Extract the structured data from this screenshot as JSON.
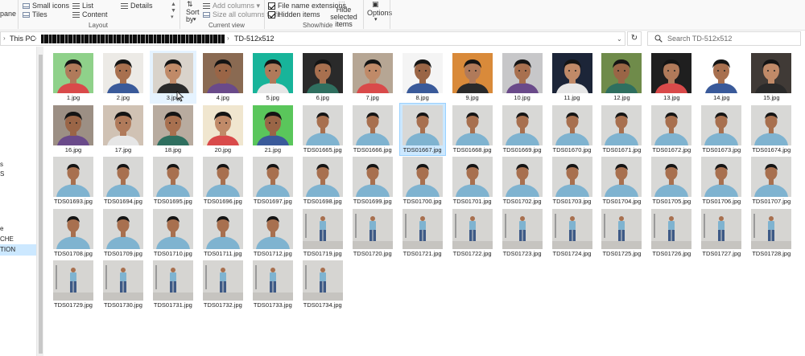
{
  "ribbon": {
    "pane_label": "pane",
    "layout": {
      "items": [
        "Small icons",
        "List",
        "Details",
        "Tiles",
        "Content"
      ],
      "group_label": "Layout"
    },
    "current_view": {
      "sort_by_label": "Sort by",
      "add_columns_label": "Add columns",
      "size_columns_label": "Size all columns to fit",
      "group_label": "Current view"
    },
    "show_hide": {
      "file_name_extensions": {
        "label": "File name extensions",
        "checked": true
      },
      "hidden_items": {
        "label": "Hidden items",
        "checked": true
      },
      "hide_selected_label": "Hide selected items",
      "group_label": "Show/hide"
    },
    "options_label": "Options"
  },
  "address": {
    "this_pc": "This PC",
    "current_folder": "TD-512x512",
    "search_placeholder": "Search TD-512x512"
  },
  "nav": {
    "items": [
      "s",
      "S",
      "e",
      "CHE",
      "TION"
    ],
    "selected_index": 4
  },
  "files": [
    "1.jpg",
    "2.jpg",
    "3.jpg",
    "4.jpg",
    "5.jpg",
    "6.jpg",
    "7.jpg",
    "8.jpg",
    "9.jpg",
    "10.jpg",
    "11.jpg",
    "12.jpg",
    "13.jpg",
    "14.jpg",
    "15.jpg",
    "16.jpg",
    "17.jpg",
    "18.jpg",
    "20.jpg",
    "21.jpg",
    "TDS01665.jpg",
    "TDS01666.jpg",
    "TDS01667.jpg",
    "TDS01668.jpg",
    "TDS01669.jpg",
    "TDS01670.jpg",
    "TDS01671.jpg",
    "TDS01672.jpg",
    "TDS01673.jpg",
    "TDS01674.jpg",
    "TDS01693.jpg",
    "TDS01694.jpg",
    "TDS01695.jpg",
    "TDS01696.jpg",
    "TDS01697.jpg",
    "TDS01698.jpg",
    "TDS01699.jpg",
    "TDS01700.jpg",
    "TDS01701.jpg",
    "TDS01702.jpg",
    "TDS01703.jpg",
    "TDS01704.jpg",
    "TDS01705.jpg",
    "TDS01706.jpg",
    "TDS01707.jpg",
    "TDS01708.jpg",
    "TDS01709.jpg",
    "TDS01710.jpg",
    "TDS01711.jpg",
    "TDS01712.jpg",
    "TDS01719.jpg",
    "TDS01720.jpg",
    "TDS01721.jpg",
    "TDS01722.jpg",
    "TDS01723.jpg",
    "TDS01724.jpg",
    "TDS01725.jpg",
    "TDS01726.jpg",
    "TDS01727.jpg",
    "TDS01728.jpg",
    "TDS01729.jpg",
    "TDS01730.jpg",
    "TDS01731.jpg",
    "TDS01732.jpg",
    "TDS01733.jpg",
    "TDS01734.jpg"
  ],
  "hovered_file": "3.jpg",
  "selected_file": "TDS01667.jpg"
}
